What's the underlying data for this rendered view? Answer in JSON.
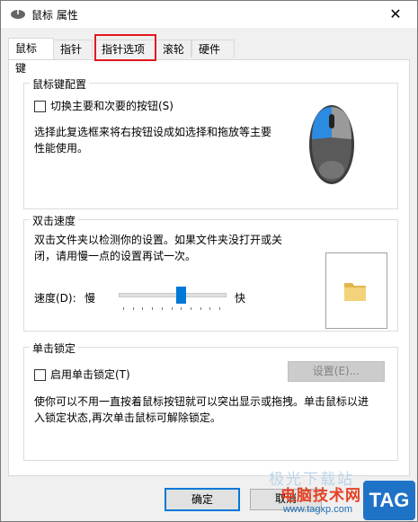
{
  "window": {
    "title": "鼠标 属性",
    "close_glyph": "✕"
  },
  "tabs": [
    {
      "label": "鼠标键",
      "active": true
    },
    {
      "label": "指针",
      "active": false
    },
    {
      "label": "指针选项",
      "active": false
    },
    {
      "label": "滚轮",
      "active": false
    },
    {
      "label": "硬件",
      "active": false
    }
  ],
  "button_config": {
    "title": "鼠标键配置",
    "switch_checkbox": {
      "label": "切换主要和次要的按钮(S)",
      "checked": false
    },
    "description_lines": [
      "选择此复选框来将右按钮设成如选择和拖放等主要",
      "性能使用。"
    ]
  },
  "double_click": {
    "title": "双击速度",
    "description_lines": [
      "双击文件夹以检测你的设置。如果文件夹没打开或关",
      "闭，请用慢一点的设置再试一次。"
    ],
    "speed_label": "速度(D):",
    "slow_label": "慢",
    "fast_label": "快",
    "speed_fraction": 0.6
  },
  "click_lock": {
    "title": "单击锁定",
    "checkbox": {
      "label": "启用单击锁定(T)",
      "checked": false
    },
    "settings_button": "设置(E)...",
    "description_lines": [
      "使你可以不用一直按着鼠标按钮就可以突出显示或拖拽。单击鼠标以进",
      "入锁定状态,再次单击鼠标可解除锁定。"
    ]
  },
  "footer": {
    "ok_button": "确定",
    "cancel_button": "取消"
  },
  "watermark": {
    "faint": "极光下载站",
    "site_name": "电脑技术网",
    "url": "www.tagxp.com",
    "badge": "TAG"
  },
  "colors": {
    "accent": "#0078d7",
    "highlight": "#e0181e",
    "tag_blue": "#1f73c7",
    "tag_red": "#e53a1c"
  }
}
